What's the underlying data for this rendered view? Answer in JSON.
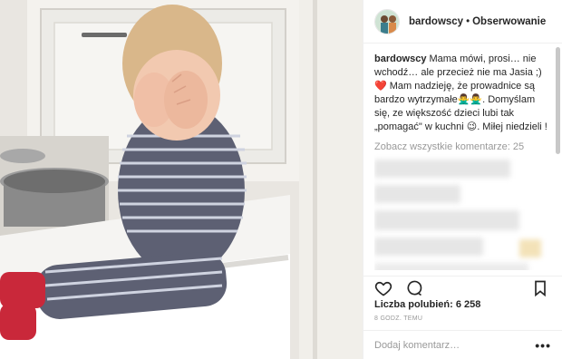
{
  "header": {
    "username": "bardowscy",
    "separator": "•",
    "follow_label": "Obserwowanie"
  },
  "caption": {
    "username": "bardowscy",
    "text": "Mama mówi, prosi… nie wchodź… ale przecież nie ma Jasia ;)❤️ Mam nadzieję, że prowadnice są bardzo wytrzymałe🙅‍♂️🙅‍♂️. Domyślam się, ze większość dzieci lubi tak „pomagać\" w kuchni 😉. Miłej niedzieli !"
  },
  "comments": {
    "view_all_label": "Zobacz wszystkie komentarze: 25"
  },
  "actions": {
    "like_icon": "heart-icon",
    "comment_icon": "comment-icon",
    "save_icon": "bookmark-icon"
  },
  "likes": {
    "label": "Liczba polubień: 6 258"
  },
  "timestamp": "8 GODZ. TEMU",
  "add_comment": {
    "placeholder": "Dodaj komentarz…",
    "more_label": "•••"
  },
  "colors": {
    "text": "#262626",
    "muted": "#999999",
    "border": "#efefef",
    "heart": "#e0245e"
  }
}
